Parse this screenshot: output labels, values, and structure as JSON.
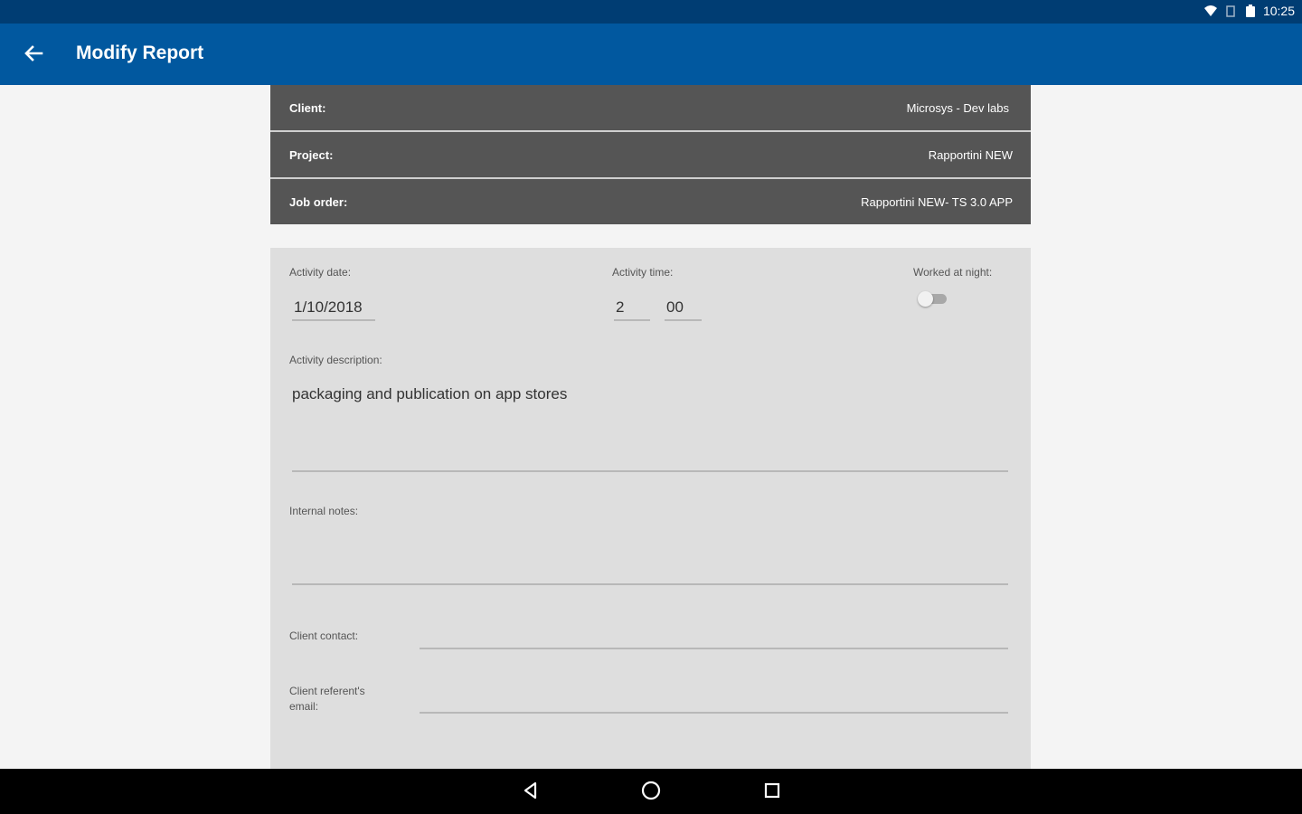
{
  "status_bar": {
    "time": "10:25",
    "icons": [
      "wifi-icon",
      "signal-icon",
      "battery-icon"
    ]
  },
  "app_bar": {
    "title": "Modify Report",
    "back_icon": "arrow-back-icon"
  },
  "info": {
    "client_label": "Client:",
    "client_value": "Microsys - Dev labs",
    "project_label": "Project:",
    "project_value": "Rapportini NEW",
    "job_order_label": "Job order:",
    "job_order_value": "Rapportini NEW- TS 3.0 APP"
  },
  "form": {
    "activity_date_label": "Activity date:",
    "activity_date_value": "1/10/2018",
    "activity_time_label": "Activity time:",
    "activity_time_hours": "2",
    "activity_time_minutes": "00",
    "worked_at_night_label": "Worked at night:",
    "worked_at_night_on": false,
    "activity_description_label": "Activity description:",
    "activity_description_value": "packaging and publication on app stores",
    "internal_notes_label": "Internal notes:",
    "internal_notes_value": "",
    "client_contact_label": "Client contact:",
    "client_contact_value": "",
    "client_referent_email_label_line1": "Client referent's",
    "client_referent_email_label_line2": "email:",
    "client_referent_email_value": ""
  },
  "nav_bar": {
    "icons": [
      "back-triangle-icon",
      "home-circle-icon",
      "recents-square-icon"
    ]
  },
  "colors": {
    "status_bar": "#003d73",
    "app_bar": "#01589f",
    "info_panel": "#555555",
    "form_panel": "#dedede",
    "nav_bar": "#000000"
  }
}
